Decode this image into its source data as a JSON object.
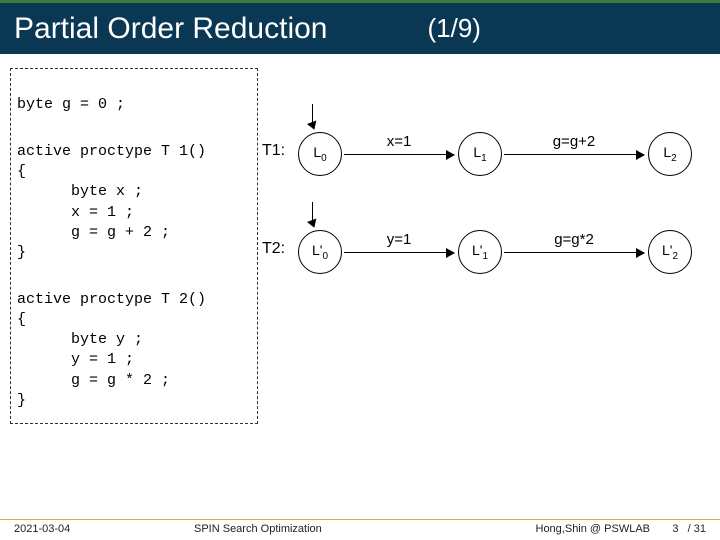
{
  "header": {
    "title": "Partial Order Reduction",
    "counter": "(1/9)"
  },
  "code": {
    "decl": "byte g = 0 ;",
    "p1_l1": "active proctype T 1()",
    "p1_l2": "{",
    "p1_l3": "      byte x ;",
    "p1_l4": "      x = 1 ;",
    "p1_l5": "      g = g + 2 ;",
    "p1_l6": "}",
    "p2_l1": "active proctype T 2()",
    "p2_l2": "{",
    "p2_l3": "      byte y ;",
    "p2_l4": "      y = 1 ;",
    "p2_l5": "      g = g * 2 ;",
    "p2_l6": "}"
  },
  "rows": [
    {
      "label": "T1:",
      "n0": "L",
      "n0s": "0",
      "e0": "x=1",
      "n1": "L",
      "n1s": "1",
      "e1": "g=g+2",
      "n2": "L",
      "n2s": "2"
    },
    {
      "label": "T2:",
      "n0": "L'",
      "n0s": "0",
      "e0": "y=1",
      "n1": "L'",
      "n1s": "1",
      "e1": "g=g*2",
      "n2": "L'",
      "n2s": "2"
    }
  ],
  "footer": {
    "date": "2021-03-04",
    "center": "SPIN Search Optimization",
    "right": "Hong,Shin @ PSWLAB",
    "page": "3",
    "total": "/ 31"
  }
}
